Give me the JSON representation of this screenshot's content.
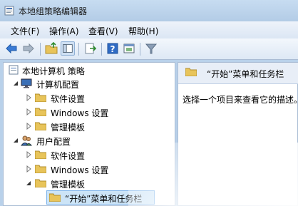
{
  "window": {
    "title": "本地组策略编辑器"
  },
  "menu": [
    "文件(F)",
    "操作(A)",
    "查看(V)",
    "帮助(H)"
  ],
  "toolbar": {
    "buttons": [
      "back-icon",
      "forward-icon",
      "up-folder-icon",
      "show-hide-tree-icon",
      "export-list-icon",
      "help-icon",
      "properties-icon",
      "filter-icon"
    ]
  },
  "tree": {
    "root": "本地计算机 策略",
    "computer_config": "计算机配置",
    "user_config": "用户配置",
    "software_settings": "软件设置",
    "windows_settings": "Windows 设置",
    "admin_templates": "管理模板",
    "start_menu": "“开始”菜单和任务栏"
  },
  "right_pane": {
    "header": "“开始”菜单和任务栏",
    "description": "选择一个项目来查看它的描述。"
  },
  "colors": {
    "folder": "#e8c45a",
    "selection": "#cce4f7"
  }
}
